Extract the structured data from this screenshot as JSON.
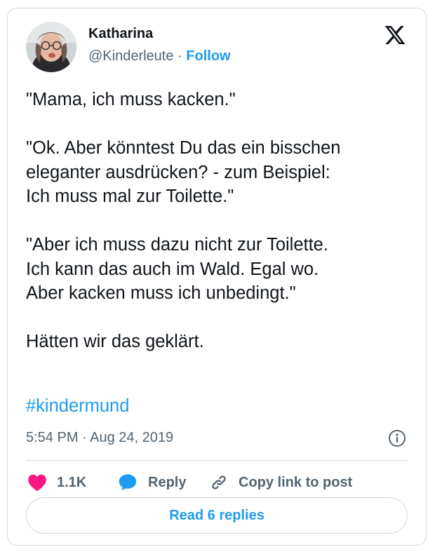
{
  "author": {
    "name": "Katharina",
    "handle": "@Kinderleute",
    "separator": "·",
    "follow_label": "Follow"
  },
  "tweet": {
    "paragraphs": [
      "\"Mama, ich muss kacken.\"",
      "\"Ok. Aber könntest Du das ein bisschen",
      "eleganter ausdrücken? - zum Beispiel:",
      "Ich muss mal zur Toilette.\"",
      "\"Aber ich muss dazu nicht zur Toilette.",
      "Ich kann das auch im Wald. Egal wo.",
      "Aber kacken muss ich unbedingt.\"",
      "Hätten wir das geklärt."
    ],
    "hashtag": "#kindermund",
    "timestamp": "5:54 PM · Aug 24, 2019"
  },
  "actions": {
    "like_count": "1.1K",
    "reply_label": "Reply",
    "copy_label": "Copy link to post"
  },
  "read_replies_label": "Read 6 replies",
  "icons": {
    "logo": "x-logo-icon",
    "info": "info-icon",
    "like": "heart-icon",
    "reply": "speech-bubble-icon",
    "copy": "link-icon"
  },
  "colors": {
    "accent": "#1d9bf0",
    "like": "#f91880",
    "text": "#0f1419",
    "muted": "#536471",
    "border": "#cfd9de"
  }
}
